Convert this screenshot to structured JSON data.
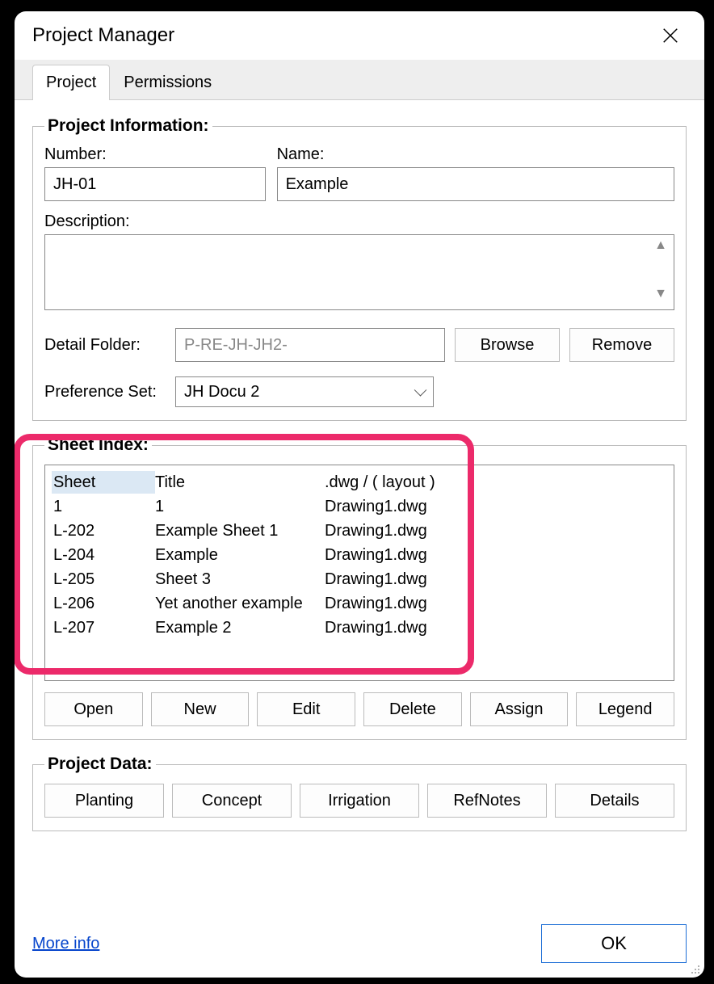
{
  "window": {
    "title": "Project Manager"
  },
  "tabs": [
    {
      "label": "Project",
      "active": true
    },
    {
      "label": "Permissions",
      "active": false
    }
  ],
  "projectInfo": {
    "legend": "Project Information:",
    "numberLabel": "Number:",
    "numberValue": "JH-01",
    "nameLabel": "Name:",
    "nameValue": "Example",
    "descriptionLabel": "Description:",
    "descriptionValue": "",
    "detailFolderLabel": "Detail Folder:",
    "detailFolderValue": "P-RE-JH-JH2-",
    "browseBtn": "Browse",
    "removeBtn": "Remove",
    "prefSetLabel": "Preference Set:",
    "prefSetValue": "JH Docu 2"
  },
  "sheetIndex": {
    "legend": "Sheet Index:",
    "headers": {
      "c1": "Sheet",
      "c2": "Title",
      "c3": ".dwg / ( layout )"
    },
    "rows": [
      {
        "sheet": "1",
        "title": "1",
        "dwg": "Drawing1.dwg"
      },
      {
        "sheet": "L-202",
        "title": "Example Sheet 1",
        "dwg": "Drawing1.dwg"
      },
      {
        "sheet": "L-204",
        "title": "Example",
        "dwg": "Drawing1.dwg"
      },
      {
        "sheet": "L-205",
        "title": "Sheet 3",
        "dwg": "Drawing1.dwg"
      },
      {
        "sheet": "L-206",
        "title": "Yet another example",
        "dwg": "Drawing1.dwg"
      },
      {
        "sheet": "L-207",
        "title": "Example 2",
        "dwg": "Drawing1.dwg"
      }
    ],
    "buttons": [
      "Open",
      "New",
      "Edit",
      "Delete",
      "Assign",
      "Legend"
    ]
  },
  "projectData": {
    "legend": "Project Data:",
    "buttons": [
      "Planting",
      "Concept",
      "Irrigation",
      "RefNotes",
      "Details"
    ]
  },
  "footer": {
    "moreInfo": "More info",
    "ok": "OK"
  }
}
